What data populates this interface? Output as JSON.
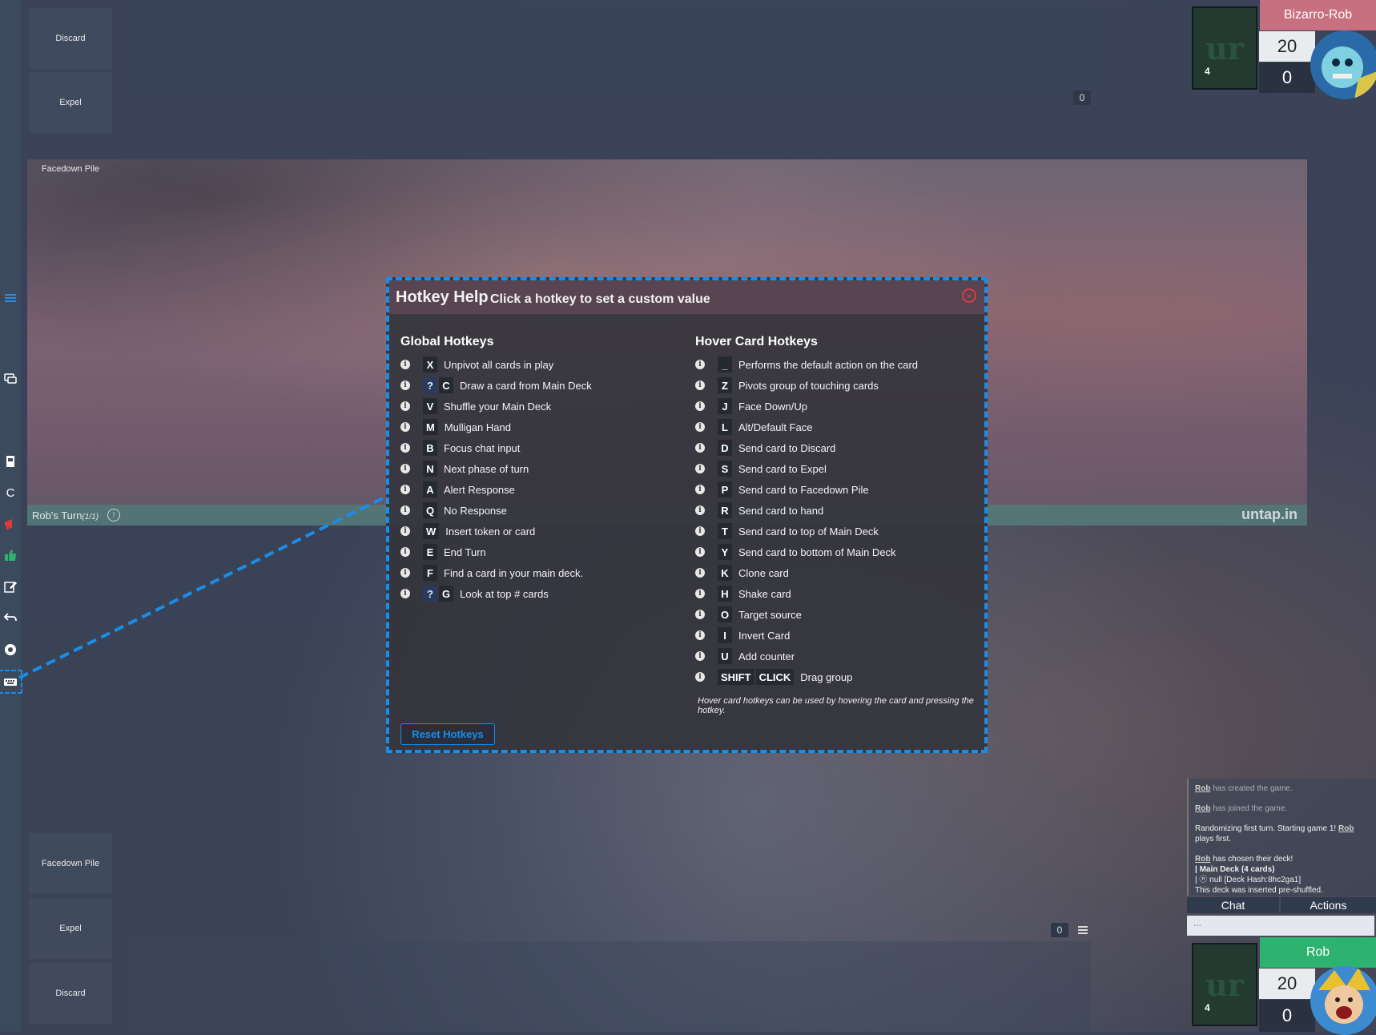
{
  "piles": {
    "opponent": [
      "Discard",
      "Expel",
      "Facedown Pile"
    ],
    "player": [
      "Facedown Pile",
      "Expel",
      "Discard"
    ]
  },
  "opponent": {
    "name": "Bizarro-Rob",
    "life": "20",
    "poison": "0",
    "deck_count": "4",
    "hand_count": "0",
    "name_bar_color": "#c7707f"
  },
  "player": {
    "name": "Rob",
    "life": "20",
    "poison": "0",
    "deck_count": "4",
    "hand_count": "0",
    "name_bar_color": "#2db36f"
  },
  "turn": {
    "label": "Rob's Turn",
    "count": "(1/1)"
  },
  "brand": "untap.in",
  "dialog": {
    "title": "Hotkey Help",
    "subtitle": "Click a hotkey to set a custom value",
    "global_heading": "Global Hotkeys",
    "hover_heading": "Hover Card Hotkeys",
    "global": [
      {
        "keys": [
          "X"
        ],
        "label": "Unpivot all cards in play"
      },
      {
        "keys": [
          "?",
          "C"
        ],
        "label": "Draw a card from Main Deck"
      },
      {
        "keys": [
          "V"
        ],
        "label": "Shuffle your Main Deck"
      },
      {
        "keys": [
          "M"
        ],
        "label": "Mulligan Hand"
      },
      {
        "keys": [
          "B"
        ],
        "label": "Focus chat input"
      },
      {
        "keys": [
          "N"
        ],
        "label": "Next phase of turn"
      },
      {
        "keys": [
          "A"
        ],
        "label": "Alert Response"
      },
      {
        "keys": [
          "Q"
        ],
        "label": "No Response"
      },
      {
        "keys": [
          "W"
        ],
        "label": "Insert token or card"
      },
      {
        "keys": [
          "E"
        ],
        "label": "End Turn"
      },
      {
        "keys": [
          "F"
        ],
        "label": "Find a card in your main deck."
      },
      {
        "keys": [
          "?",
          "G"
        ],
        "label": "Look at top # cards"
      }
    ],
    "hover": [
      {
        "keys": [
          "_"
        ],
        "label": "Performs the default action on the card"
      },
      {
        "keys": [
          "Z"
        ],
        "label": "Pivots group of touching cards"
      },
      {
        "keys": [
          "J"
        ],
        "label": "Face Down/Up"
      },
      {
        "keys": [
          "L"
        ],
        "label": "Alt/Default Face"
      },
      {
        "keys": [
          "D"
        ],
        "label": "Send card to Discard"
      },
      {
        "keys": [
          "S"
        ],
        "label": "Send card to Expel"
      },
      {
        "keys": [
          "P"
        ],
        "label": "Send card to Facedown Pile"
      },
      {
        "keys": [
          "R"
        ],
        "label": "Send card to hand"
      },
      {
        "keys": [
          "T"
        ],
        "label": "Send card to top of Main Deck"
      },
      {
        "keys": [
          "Y"
        ],
        "label": "Send card to bottom of Main Deck"
      },
      {
        "keys": [
          "K"
        ],
        "label": "Clone card"
      },
      {
        "keys": [
          "H"
        ],
        "label": "Shake card"
      },
      {
        "keys": [
          "O"
        ],
        "label": "Target source"
      },
      {
        "keys": [
          "I"
        ],
        "label": "Invert Card"
      },
      {
        "keys": [
          "U"
        ],
        "label": "Add counter"
      },
      {
        "keys": [
          "SHIFT",
          "CLICK"
        ],
        "label": "Drag group"
      }
    ],
    "hover_note": "Hover card hotkeys can be used by hovering the card and pressing the hotkey.",
    "reset_label": "Reset Hotkeys",
    "accent": "#1a8de8"
  },
  "chat": {
    "log": [
      {
        "user": "Rob",
        "text": " has created the game."
      },
      {
        "user": "Rob",
        "text": " has joined the game."
      },
      {
        "pre": "Randomizing first turn. Starting game 1! ",
        "user": "Rob",
        "text": " plays first."
      },
      {
        "user": "Rob",
        "text": " has chosen their deck!",
        "lines": [
          "|  Main Deck (4 cards)",
          "|  ⓝ null [Deck Hash:8hc2ga1]",
          "This deck was inserted pre-shuffled."
        ]
      }
    ],
    "tabs": [
      "Chat",
      "Actions"
    ],
    "input_placeholder": "..."
  },
  "rail_icons": [
    "menu-icon",
    "chat-bubbles-icon",
    "deck-icon",
    "counter-c-icon",
    "megaphone-icon",
    "thumbs-up-icon",
    "edit-icon",
    "undo-icon",
    "dice-icon",
    "keyboard-icon"
  ]
}
